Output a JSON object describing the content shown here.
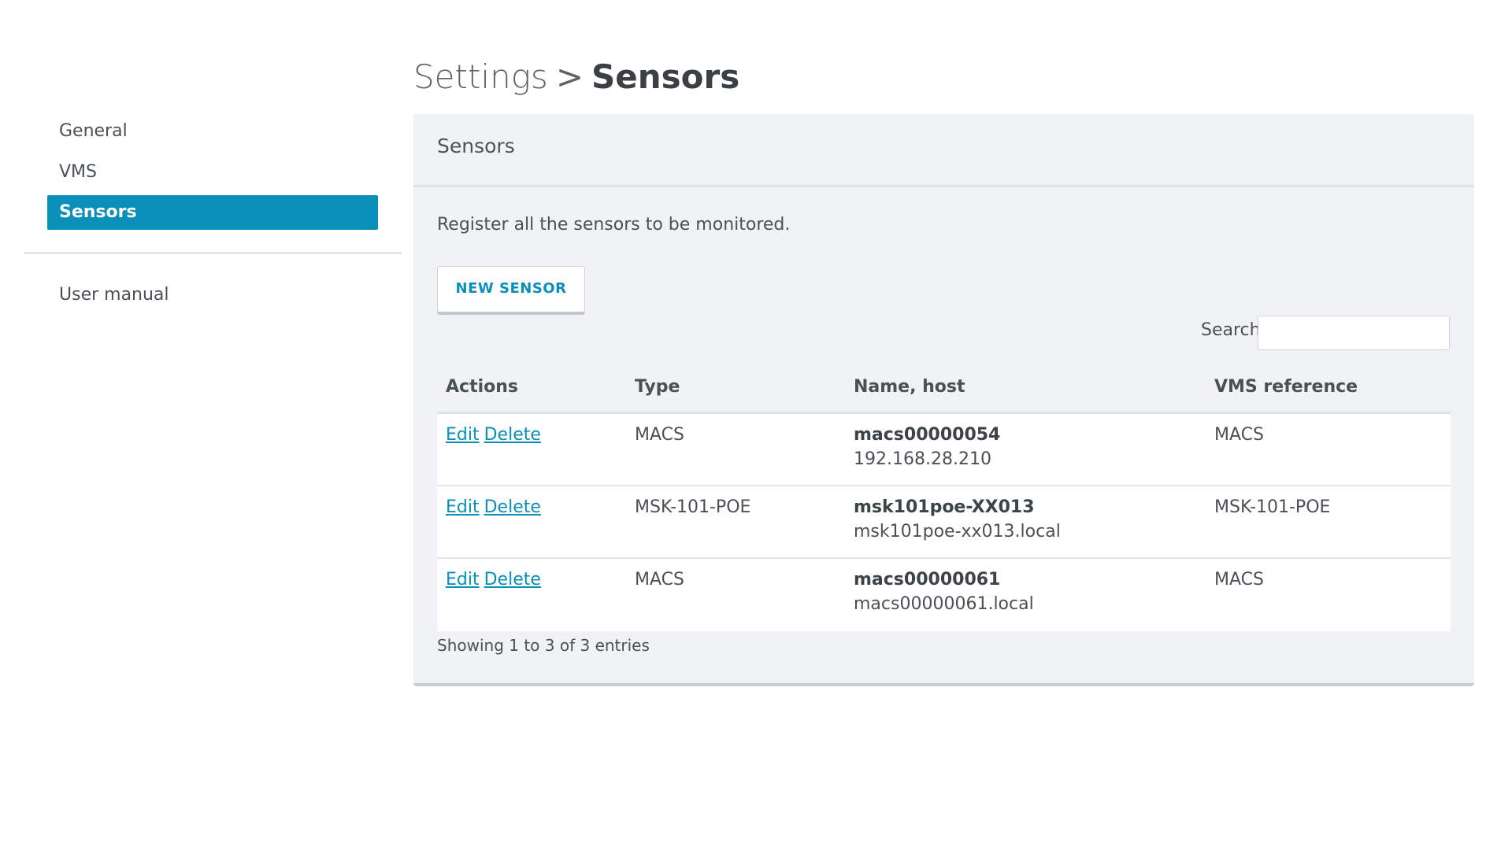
{
  "breadcrumb": {
    "parent": "Settings",
    "separator": ">",
    "current": "Sensors"
  },
  "sidebar": {
    "items": [
      {
        "label": "General",
        "active": false
      },
      {
        "label": "VMS",
        "active": false
      },
      {
        "label": "Sensors",
        "active": true
      }
    ],
    "secondary_items": [
      {
        "label": "User manual"
      }
    ]
  },
  "card": {
    "title": "Sensors",
    "description": "Register all the sensors to be monitored.",
    "new_button_label": "NEW SENSOR",
    "search_label": "Search:",
    "search_value": ""
  },
  "table": {
    "headers": [
      "Actions",
      "Type",
      "Name, host",
      "VMS reference"
    ],
    "action_labels": {
      "edit": "Edit",
      "delete": "Delete"
    },
    "rows": [
      {
        "type": "MACS",
        "name": "macs00000054",
        "host": "192.168.28.210",
        "vms_reference": "MACS"
      },
      {
        "type": "MSK-101-POE",
        "name": "msk101poe-XX013",
        "host": "msk101poe-xx013.local",
        "vms_reference": "MSK-101-POE"
      },
      {
        "type": "MACS",
        "name": "macs00000061",
        "host": "macs00000061.local",
        "vms_reference": "MACS"
      }
    ],
    "footer": "Showing 1 to 3 of 3 entries"
  },
  "colors": {
    "accent": "#0a8fb9",
    "card_background": "#f1f2f4",
    "text": "#4a5155"
  }
}
